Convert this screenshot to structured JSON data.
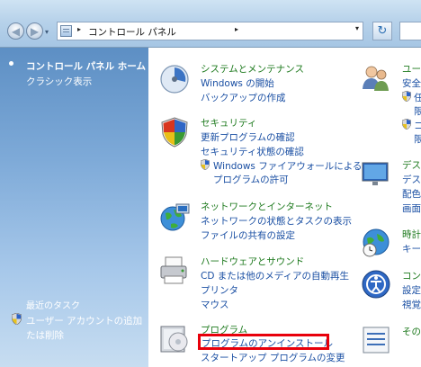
{
  "address": {
    "breadcrumb": "コントロール パネル",
    "sep": "▸",
    "back": "◀",
    "forward": "▶",
    "history": "▾",
    "dropdown": "▾",
    "refresh": "↻"
  },
  "sidebar": {
    "home": "コントロール パネル ホーム",
    "classic": "クラシック表示",
    "tasks_title": "最近のタスク",
    "task_line1": "ユーザー アカウントの追加",
    "task_line2": "たは削除"
  },
  "categories": {
    "system": {
      "title": "システムとメンテナンス",
      "links": [
        "Windows の開始",
        "バックアップの作成"
      ]
    },
    "security": {
      "title": "セキュリティ",
      "links": [
        "更新プログラムの確認",
        "セキュリティ状態の確認",
        "Windows ファイアウォールによる",
        "プログラムの許可"
      ]
    },
    "network": {
      "title": "ネットワークとインターネット",
      "links": [
        "ネットワークの状態とタスクの表示",
        "ファイルの共有の設定"
      ]
    },
    "hardware": {
      "title": "ハードウェアとサウンド",
      "links": [
        "CD または他のメディアの自動再生",
        "プリンタ",
        "マウス"
      ]
    },
    "programs": {
      "title": "プログラム",
      "links": [
        "プログラムのアンインストール",
        "スタートアップ プログラムの変更"
      ]
    }
  },
  "right_column": {
    "users_title": "ユー",
    "users_links": [
      "安全",
      "任",
      "限",
      "コ",
      "限"
    ],
    "desktop_title": "デス",
    "desktop_links": [
      "デス",
      "配色",
      "画面"
    ],
    "clock_title": "時計",
    "clock_links": [
      "キー"
    ],
    "access_title": "コン",
    "access_links": [
      "設定",
      "視覚"
    ],
    "other_title": "その"
  },
  "colors": {
    "category_title": "#1e7a1e",
    "link": "#1a4fa3",
    "highlight_border": "#e8000b",
    "sidebar_top": "#5d8fc4"
  }
}
